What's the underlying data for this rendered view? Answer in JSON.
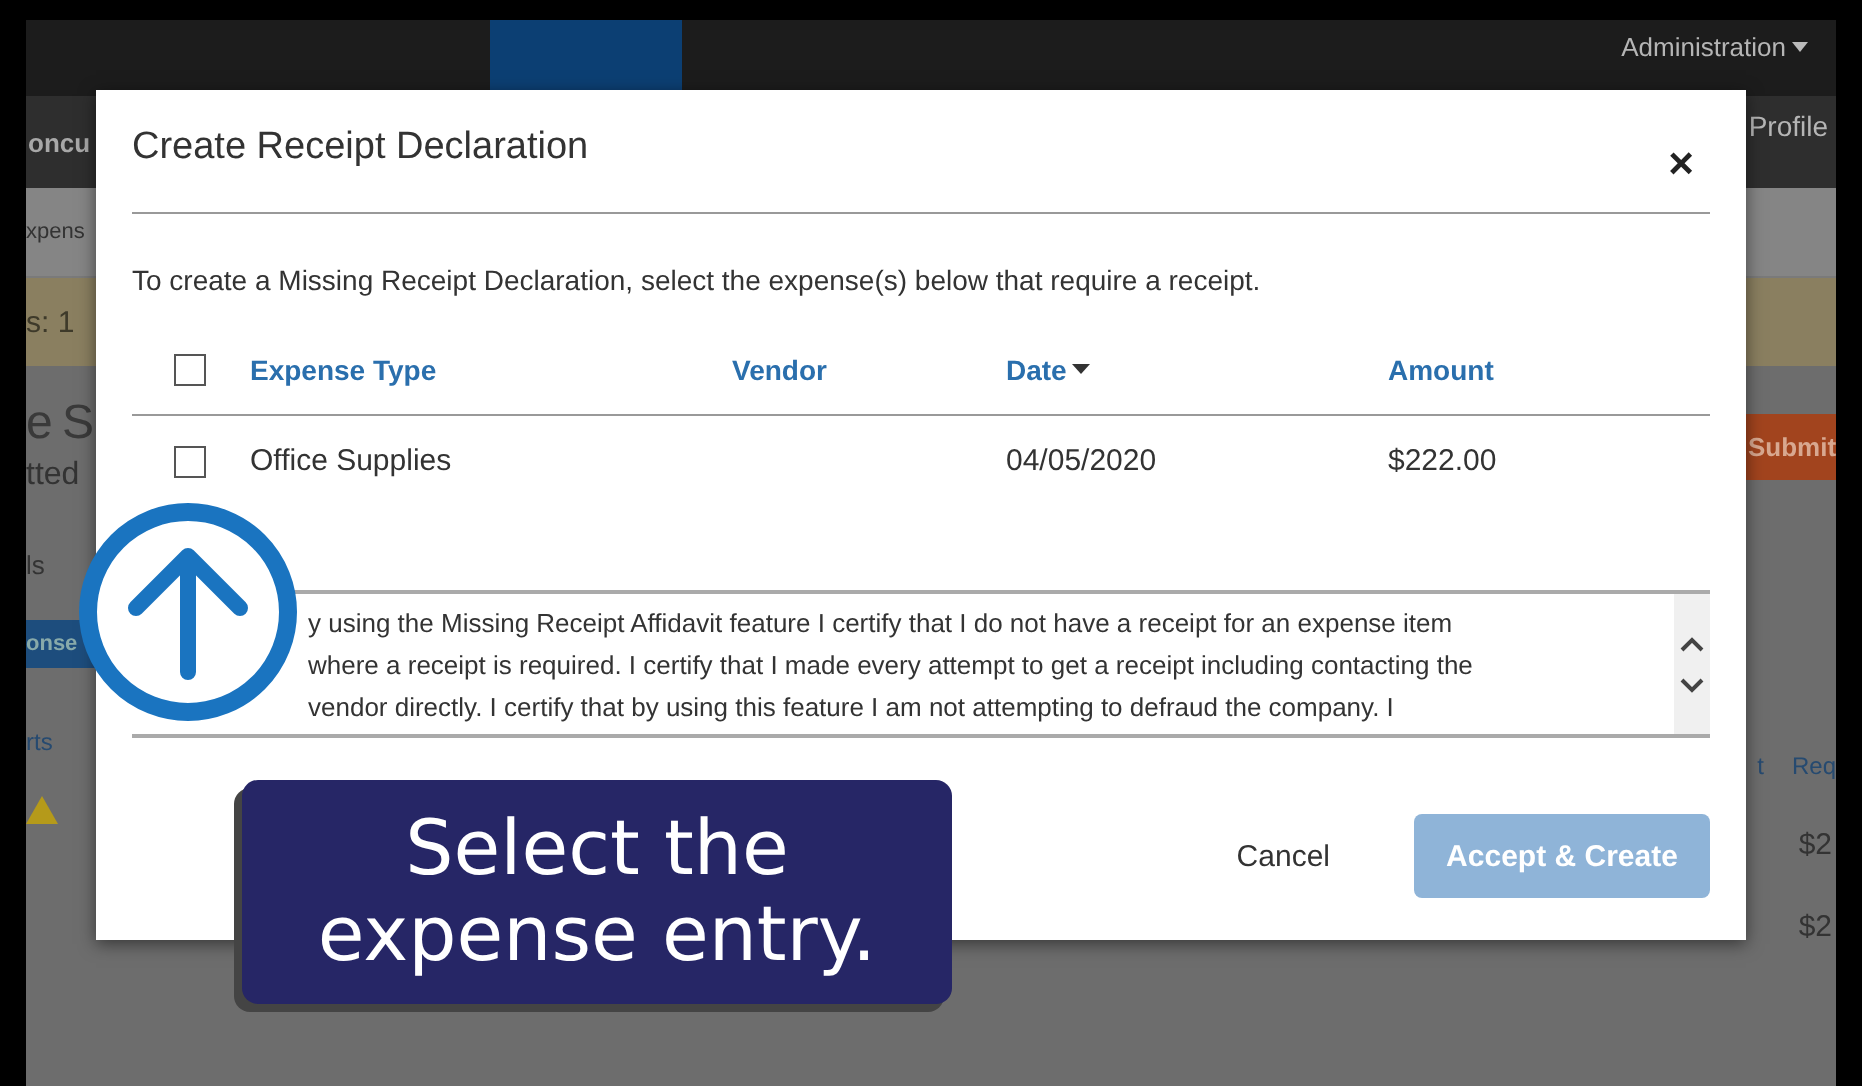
{
  "background": {
    "admin_menu": "Administration",
    "profile_link": "Profile",
    "logo": "oncu",
    "tab": "xpens",
    "count": "s: 1",
    "report_title": "e S",
    "report_status": "tted",
    "details_menu": "ls",
    "section_tab": "onse",
    "submit_button": "Submit",
    "columns": [
      "rts",
      "t",
      "Req"
    ],
    "amounts": [
      "$2",
      "$2"
    ]
  },
  "modal": {
    "title": "Create Receipt Declaration",
    "close": "×",
    "instruction": "To create a Missing Receipt Declaration, select the expense(s) below that require a receipt.",
    "select_all": {
      "checked": false
    },
    "columns": [
      {
        "label": "Expense Type",
        "sorted": false
      },
      {
        "label": "Vendor",
        "sorted": false
      },
      {
        "label": "Date",
        "sorted": true
      },
      {
        "label": "Amount",
        "sorted": false
      }
    ],
    "rows": [
      {
        "checked": false,
        "expense_type": "Office Supplies",
        "date": "04/05/2020",
        "amount": "$222.00"
      }
    ],
    "affidavit": [
      "y using the Missing Receipt Affidavit feature I certify that I do not have a receipt for an expense item",
      "where a receipt is required. I certify that I made every attempt to get a receipt including contacting the",
      "vendor directly. I certify that by using this feature I am not attempting to defraud the company. I"
    ],
    "buttons": [
      {
        "kind": "link",
        "label": "Cancel",
        "disabled": false
      },
      {
        "kind": "primary",
        "label": "Accept & Create",
        "disabled": true
      }
    ]
  },
  "callout": {
    "text": "Select the expense entry."
  }
}
